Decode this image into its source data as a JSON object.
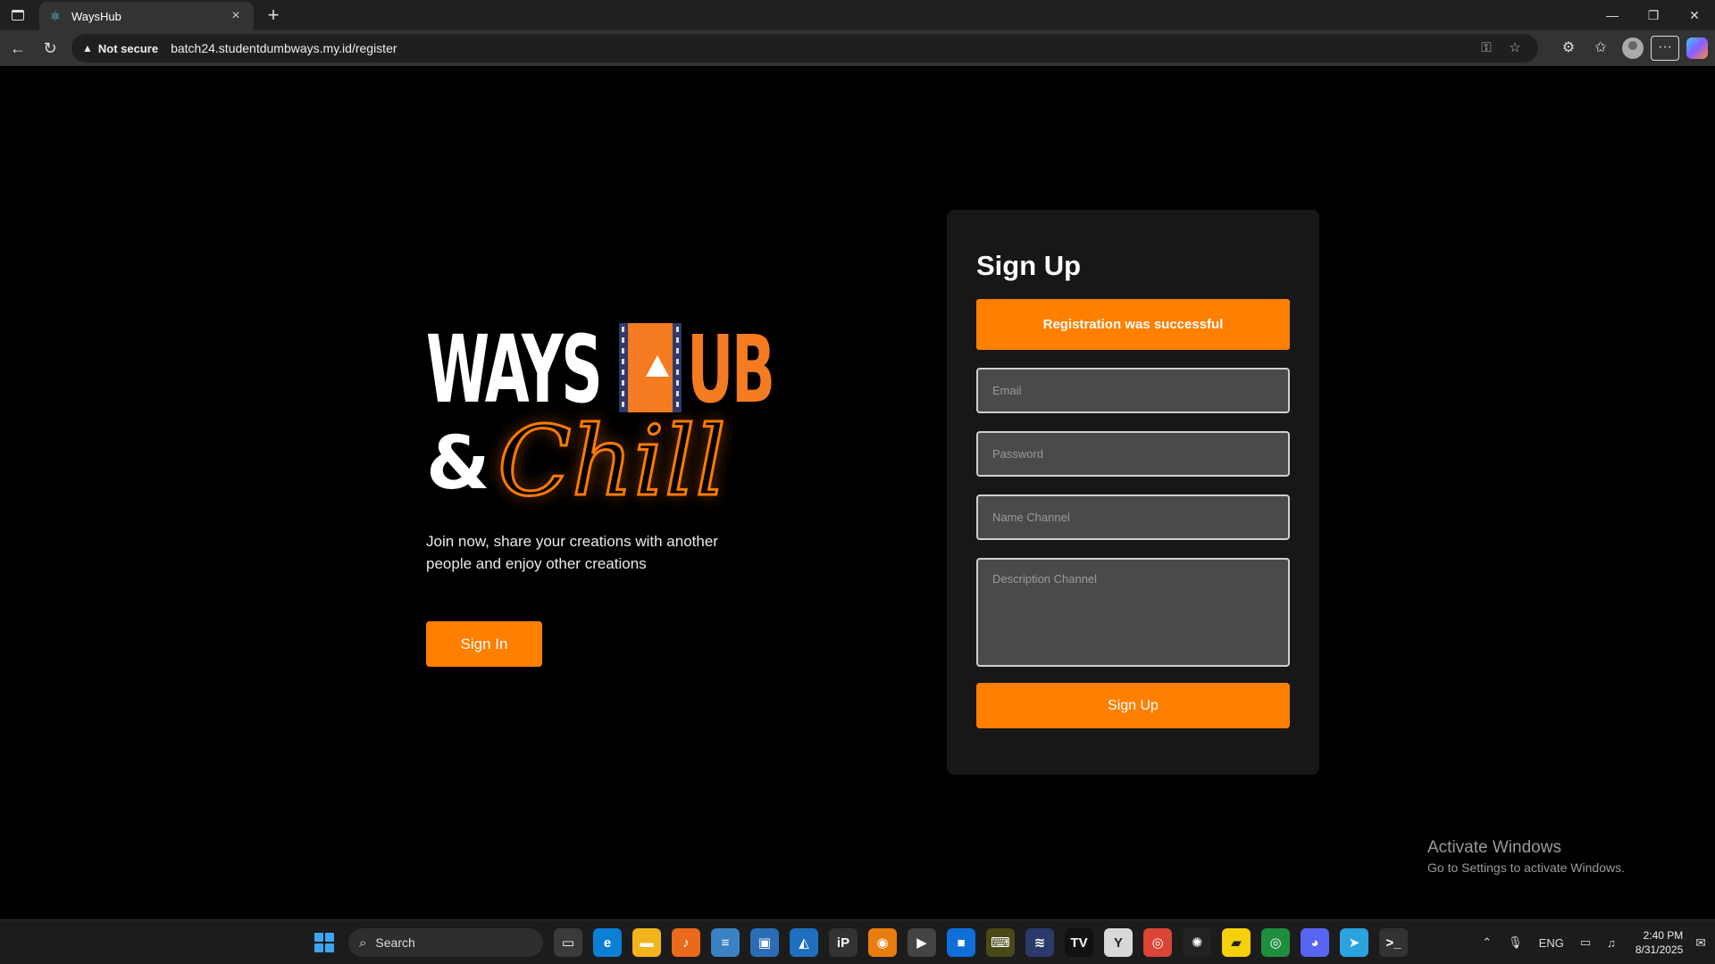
{
  "browser": {
    "tab_title": "WaysHub",
    "tab_favicon": "react-icon",
    "security_label": "Not secure",
    "url": "batch24.studentdumbways.my.id/register"
  },
  "hero": {
    "logo_ways": "WAYS",
    "logo_ub": "UB",
    "logo_amp": "&",
    "logo_chill": "Chill",
    "tagline": "Join now, share your creations with another people and enjoy other creations",
    "signin_label": "Sign In"
  },
  "form": {
    "title": "Sign Up",
    "alert": "Registration was successful",
    "email_placeholder": "Email",
    "password_placeholder": "Password",
    "name_channel_placeholder": "Name Channel",
    "description_placeholder": "Description Channel",
    "submit_label": "Sign Up"
  },
  "watermark": {
    "line1": "Activate Windows",
    "line2": "Go to Settings to activate Windows."
  },
  "taskbar": {
    "search_label": "Search",
    "language": "ENG",
    "time": "2:40 PM",
    "date": "8/31/2025"
  },
  "colors": {
    "accent": "#ff7f00",
    "card_bg": "#171717",
    "input_bg": "#4a4a4a",
    "film_blue": "#2e3a6b"
  }
}
